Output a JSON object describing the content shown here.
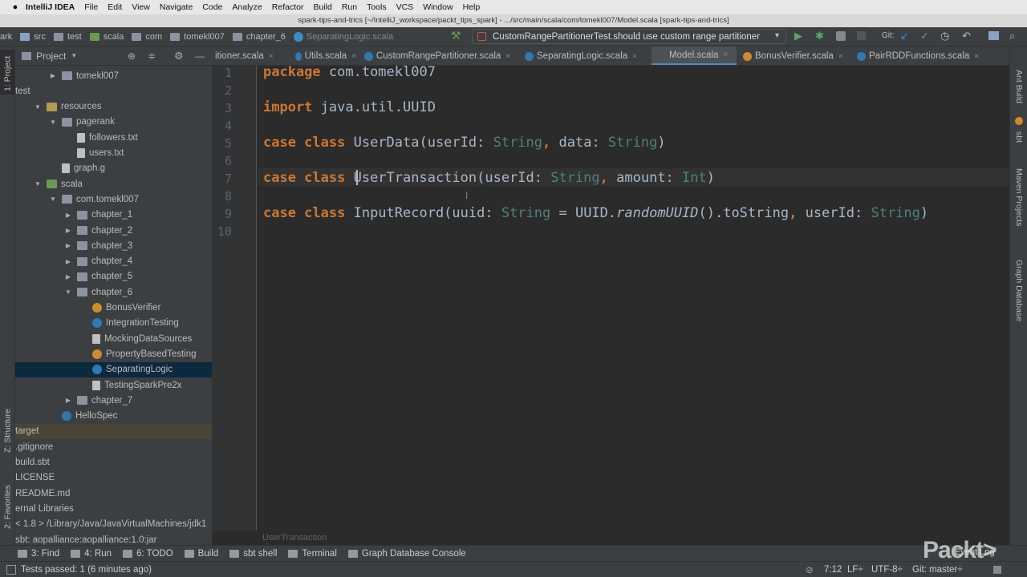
{
  "menubar": {
    "app_name": "IntelliJ IDEA",
    "items": [
      "File",
      "Edit",
      "View",
      "Navigate",
      "Code",
      "Analyze",
      "Refactor",
      "Build",
      "Run",
      "Tools",
      "VCS",
      "Window",
      "Help"
    ]
  },
  "window_title": "spark-tips-and-trics [~/IntelliJ_workspace/packt_tips_spark] - .../src/main/scala/com/tomekl007/Model.scala [spark-tips-and-trics]",
  "breadcrumbs": [
    "ark",
    "src",
    "test",
    "scala",
    "com",
    "tomekl007",
    "chapter_6",
    "SeparatingLogic.scala"
  ],
  "run_config": "CustomRangePartitionerTest.should use custom range partitioner",
  "git_label": "Git:",
  "project_panel": {
    "title": "Project",
    "rows": [
      {
        "label": "tomekl007",
        "depth": 2,
        "arrow": "▶",
        "icon": "pkg"
      },
      {
        "label": "test",
        "depth": 0,
        "arrow": "",
        "icon": "none"
      },
      {
        "label": "resources",
        "depth": 1,
        "arrow": "▼",
        "icon": "rfolder"
      },
      {
        "label": "pagerank",
        "depth": 2,
        "arrow": "▼",
        "icon": "folder"
      },
      {
        "label": "followers.txt",
        "depth": 3,
        "arrow": "",
        "icon": "file"
      },
      {
        "label": "users.txt",
        "depth": 3,
        "arrow": "",
        "icon": "file"
      },
      {
        "label": "graph.g",
        "depth": 2,
        "arrow": "",
        "icon": "file"
      },
      {
        "label": "scala",
        "depth": 1,
        "arrow": "▼",
        "icon": "gfolder"
      },
      {
        "label": "com.tomekl007",
        "depth": 2,
        "arrow": "▼",
        "icon": "pkg"
      },
      {
        "label": "chapter_1",
        "depth": 3,
        "arrow": "▶",
        "icon": "pkg"
      },
      {
        "label": "chapter_2",
        "depth": 3,
        "arrow": "▶",
        "icon": "pkg"
      },
      {
        "label": "chapter_3",
        "depth": 3,
        "arrow": "▶",
        "icon": "pkg"
      },
      {
        "label": "chapter_4",
        "depth": 3,
        "arrow": "▶",
        "icon": "pkg"
      },
      {
        "label": "chapter_5",
        "depth": 3,
        "arrow": "▶",
        "icon": "pkg"
      },
      {
        "label": "chapter_6",
        "depth": 3,
        "arrow": "▼",
        "icon": "pkg"
      },
      {
        "label": "BonusVerifier",
        "depth": 4,
        "arrow": "",
        "icon": "obj"
      },
      {
        "label": "IntegrationTesting",
        "depth": 4,
        "arrow": "",
        "icon": "scala"
      },
      {
        "label": "MockingDataSources",
        "depth": 4,
        "arrow": "",
        "icon": "file"
      },
      {
        "label": "PropertyBasedTesting",
        "depth": 4,
        "arrow": "",
        "icon": "obj"
      },
      {
        "label": "SeparatingLogic",
        "depth": 4,
        "arrow": "",
        "icon": "scala",
        "selected": true
      },
      {
        "label": "TestingSparkPre2x",
        "depth": 4,
        "arrow": "",
        "icon": "file"
      },
      {
        "label": "chapter_7",
        "depth": 3,
        "arrow": "▶",
        "icon": "pkg"
      },
      {
        "label": "HelloSpec",
        "depth": 2,
        "arrow": "",
        "icon": "scala"
      },
      {
        "label": "target",
        "depth": 0,
        "arrow": "",
        "icon": "none",
        "highlight": true
      },
      {
        "label": ".gitignore",
        "depth": 0,
        "arrow": "",
        "icon": "none"
      },
      {
        "label": "build.sbt",
        "depth": 0,
        "arrow": "",
        "icon": "none"
      },
      {
        "label": "LICENSE",
        "depth": 0,
        "arrow": "",
        "icon": "none"
      },
      {
        "label": "README.md",
        "depth": 0,
        "arrow": "",
        "icon": "none"
      },
      {
        "label": "ernal Libraries",
        "depth": 0,
        "arrow": "",
        "icon": "none"
      },
      {
        "label": "< 1.8 > /Library/Java/JavaVirtualMachines/jdk1",
        "depth": 0,
        "arrow": "",
        "icon": "none"
      },
      {
        "label": "sbt: aopalliance:aopalliance:1.0:jar",
        "depth": 0,
        "arrow": "",
        "icon": "none"
      }
    ]
  },
  "tabs": [
    {
      "label": "itioner.scala",
      "icon": "none"
    },
    {
      "label": "Utils.scala",
      "icon": "scala"
    },
    {
      "label": "CustomRangePartitioner.scala",
      "icon": "scala"
    },
    {
      "label": "SeparatingLogic.scala",
      "icon": "scala"
    },
    {
      "label": "Model.scala",
      "icon": "none",
      "active": true
    },
    {
      "label": "BonusVerifier.scala",
      "icon": "obj"
    },
    {
      "label": "PairRDDFunctions.scala",
      "icon": "scala"
    }
  ],
  "line_numbers": [
    "1",
    "2",
    "3",
    "4",
    "5",
    "6",
    "7",
    "8",
    "9",
    "10"
  ],
  "code": {
    "l1": [
      [
        "kw",
        "package "
      ],
      [
        "pl",
        "com.tomekl007"
      ]
    ],
    "l3": [
      [
        "kw",
        "import "
      ],
      [
        "pl",
        "java.util.UUID"
      ]
    ],
    "l5": [
      [
        "kw",
        "case class "
      ],
      [
        "pl",
        "UserData(userId: "
      ],
      [
        "ty",
        "String"
      ],
      [
        "kw",
        ","
      ],
      [
        "pl",
        " data: "
      ],
      [
        "ty",
        "String"
      ],
      [
        "pl",
        ")"
      ]
    ],
    "l7": [
      [
        "kw",
        "case class "
      ],
      [
        "pl",
        "UserTransaction(userId: "
      ],
      [
        "ty",
        "String"
      ],
      [
        "kw",
        ","
      ],
      [
        "pl",
        " amount: "
      ],
      [
        "ty",
        "Int"
      ],
      [
        "pl",
        ")"
      ]
    ],
    "l9": [
      [
        "kw",
        "case class "
      ],
      [
        "pl",
        "InputRecord(uuid: "
      ],
      [
        "ty",
        "String"
      ],
      [
        "pl",
        " = UUID."
      ],
      [
        "it",
        "randomUUID"
      ],
      [
        "pl",
        "().toString"
      ],
      [
        "kw",
        ","
      ],
      [
        "pl",
        " userId: "
      ],
      [
        "ty",
        "String"
      ],
      [
        "pl",
        ")"
      ]
    ]
  },
  "editor_breadcrumb": "UserTransaction",
  "left_tool_labels": [
    "1: Project",
    "Z: Structure",
    "2: Favorites"
  ],
  "right_tool_labels": [
    "Ant Build",
    "sbt",
    "Maven Projects",
    "Graph Database"
  ],
  "bottom_tools": [
    {
      "label": "3: Find",
      "icon": "search-icon"
    },
    {
      "label": "4: Run",
      "icon": "run-icon"
    },
    {
      "label": "6: TODO",
      "icon": "todo-icon"
    },
    {
      "label": "Build",
      "icon": "build-icon"
    },
    {
      "label": "sbt shell",
      "icon": "sbt-icon"
    },
    {
      "label": "Terminal",
      "icon": "terminal-icon"
    },
    {
      "label": "Graph Database Console",
      "icon": "graph-icon"
    }
  ],
  "event_log_label": "Event Log",
  "status": {
    "message": "Tests passed: 1 (6 minutes ago)",
    "position": "7:12",
    "line_sep": "LF÷",
    "encoding": "UTF-8÷",
    "git": "Git: master÷"
  },
  "watermark": "Packt>"
}
